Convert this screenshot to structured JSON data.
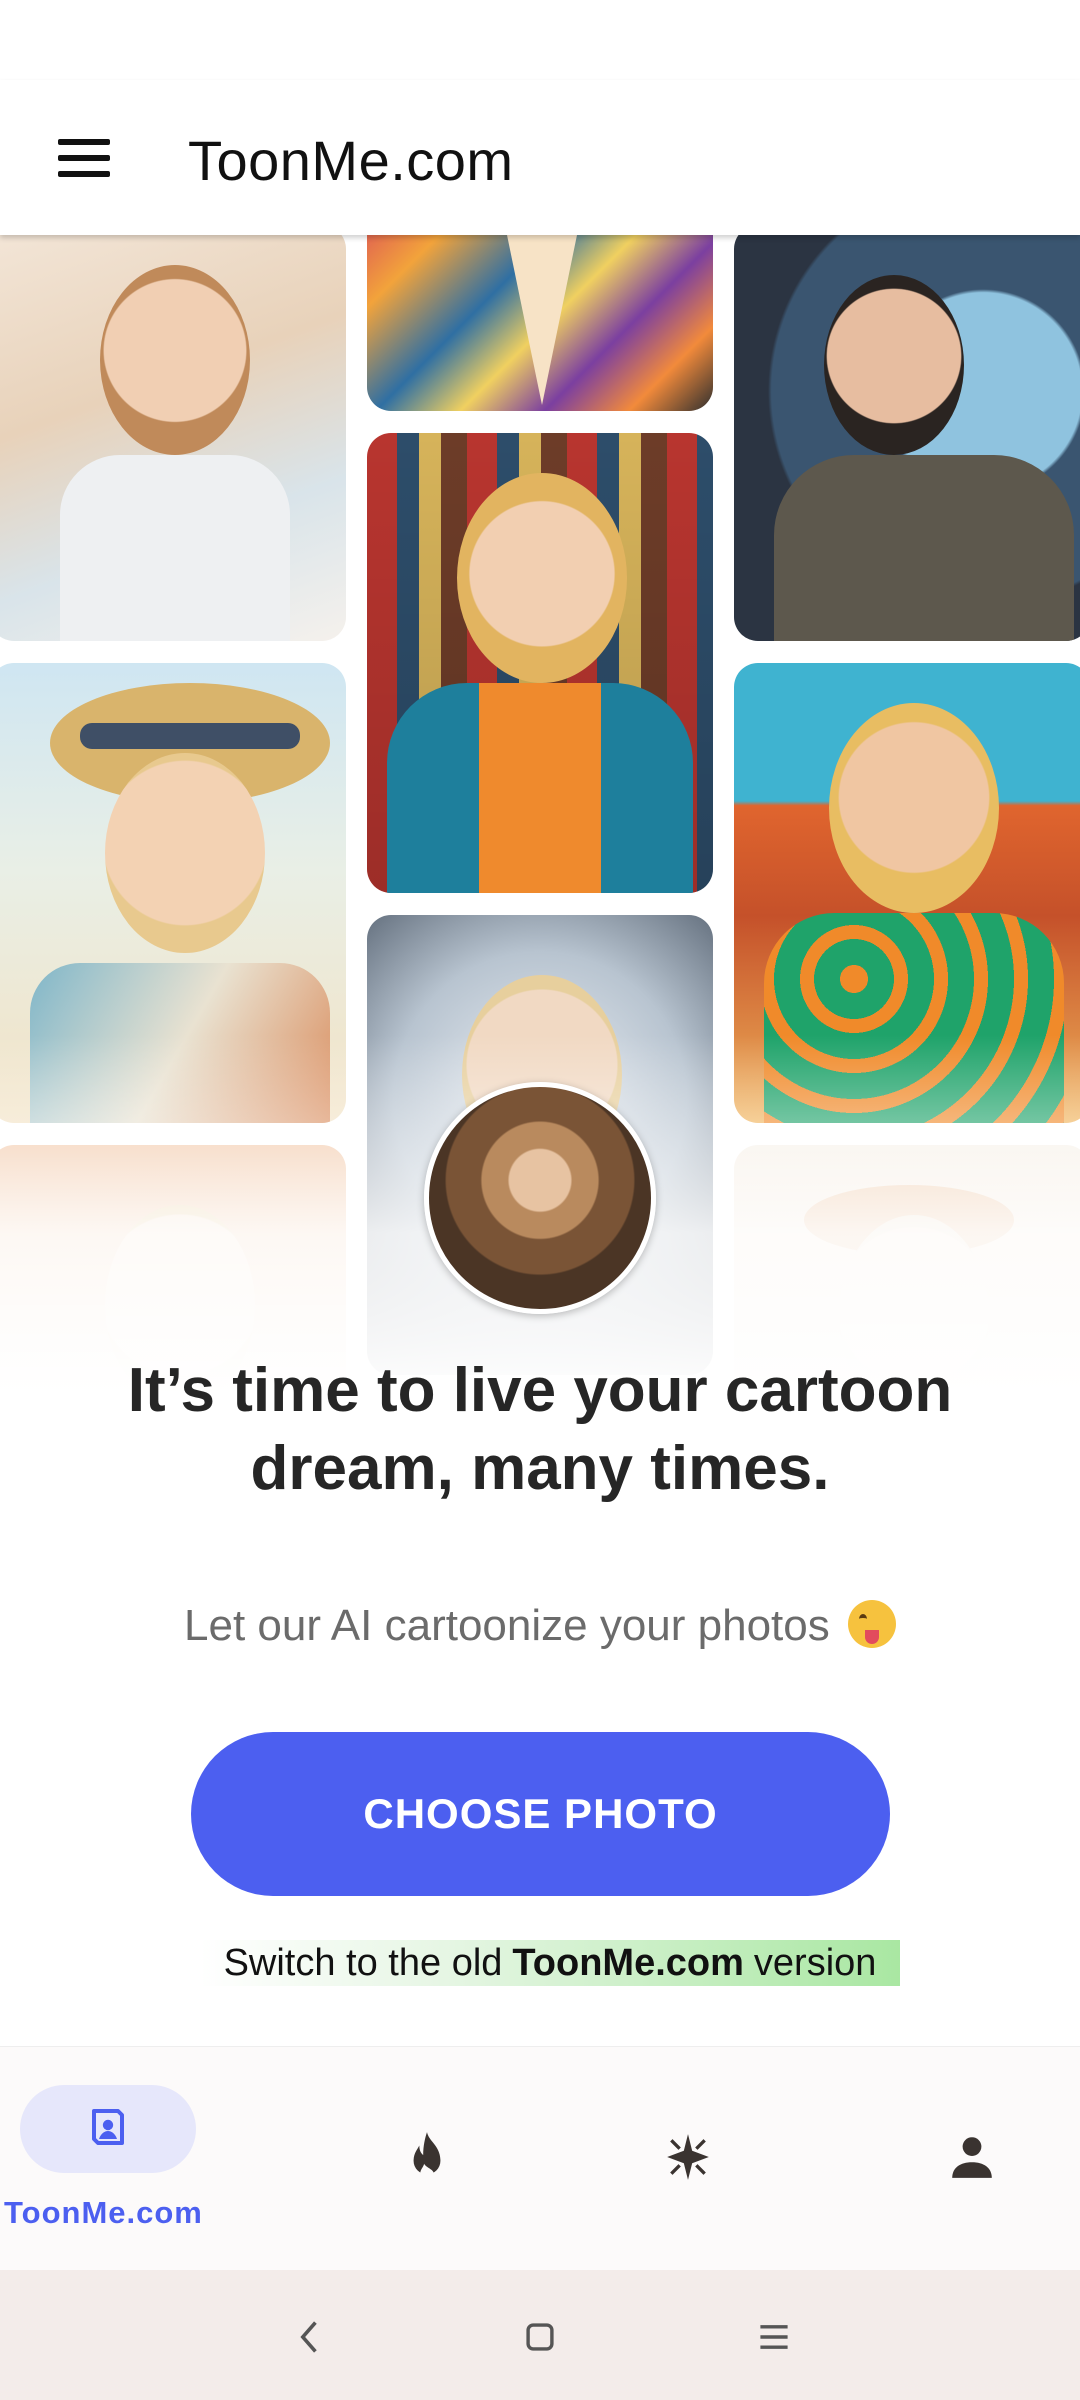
{
  "app_bar": {
    "title": "ToonMe.com",
    "menu_icon": "hamburger-menu-icon"
  },
  "gallery": {
    "images": [
      "watercolor-woman-portrait",
      "stained-glass-portrait",
      "moonlit-woman-portrait",
      "blonde-woman-bookshelf-portrait",
      "straw-hat-woman-portrait",
      "desert-blonde-floral-shirt-portrait",
      "starry-blonde-portrait",
      "city-autumn-watercolor-portrait",
      "crowned-floral-portrait"
    ],
    "user_photo": "user-photo-avatar"
  },
  "hero": {
    "headline_line1": "It’s time to live your cartoon",
    "headline_line2": "dream, many times.",
    "subtitle": "Let our AI cartoonize your photos",
    "subtitle_emoji": "tongue-wink-emoji"
  },
  "cta": {
    "label": "CHOOSE PHOTO",
    "color": "#4c5ff0"
  },
  "switch_link": {
    "prefix": "Switch to the old",
    "brand": "ToonMe.com",
    "suffix": "version"
  },
  "bottom_nav": {
    "items": [
      {
        "label": "ToonMe.com",
        "icon": "portrait-frame-icon",
        "active": true
      },
      {
        "label": "",
        "icon": "flame-icon",
        "active": false
      },
      {
        "label": "",
        "icon": "sparkle-icon",
        "active": false
      },
      {
        "label": "",
        "icon": "person-icon",
        "active": false
      }
    ]
  },
  "system_nav": {
    "back": "back-chevron-icon",
    "home": "home-square-icon",
    "recents": "menu-lines-icon"
  }
}
